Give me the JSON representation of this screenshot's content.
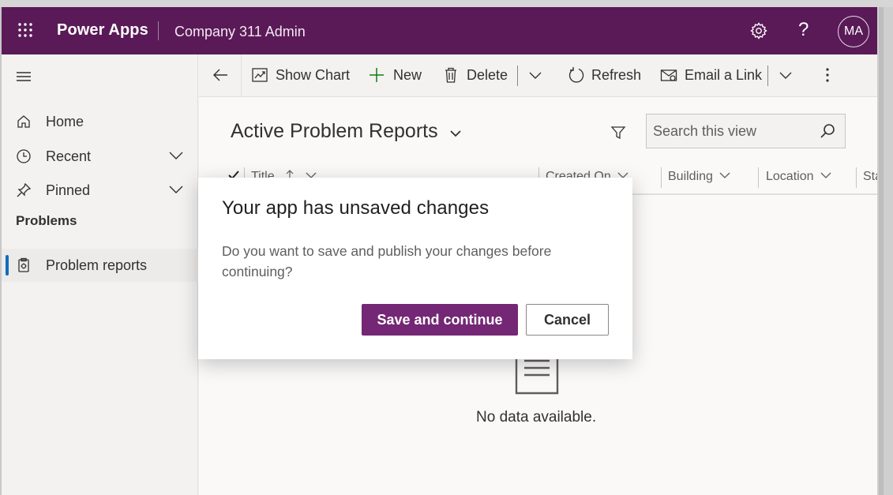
{
  "header": {
    "app_name": "Power Apps",
    "environment": "Company 311 Admin",
    "help_label": "?",
    "avatar_initials": "MA",
    "brand_color": "#5a1a57"
  },
  "sidebar": {
    "items": [
      {
        "label": "Home",
        "icon": "home-icon"
      },
      {
        "label": "Recent",
        "icon": "clock-icon"
      },
      {
        "label": "Pinned",
        "icon": "pin-icon"
      }
    ],
    "section_title": "Problems",
    "section_items": [
      {
        "label": "Problem reports",
        "icon": "report-icon",
        "selected": true
      }
    ]
  },
  "commandbar": {
    "show_chart": "Show Chart",
    "new": "New",
    "delete": "Delete",
    "refresh": "Refresh",
    "email_link": "Email a Link"
  },
  "view": {
    "title": "Active Problem Reports",
    "search_placeholder": "Search this view",
    "columns": [
      "Title",
      "Created On",
      "Building",
      "Location",
      "Sta"
    ],
    "empty_text": "No data available."
  },
  "dialog": {
    "title": "Your app has unsaved changes",
    "body": "Do you want to save and publish your changes before continuing?",
    "primary_label": "Save and continue",
    "secondary_label": "Cancel",
    "primary_color": "#742774"
  }
}
